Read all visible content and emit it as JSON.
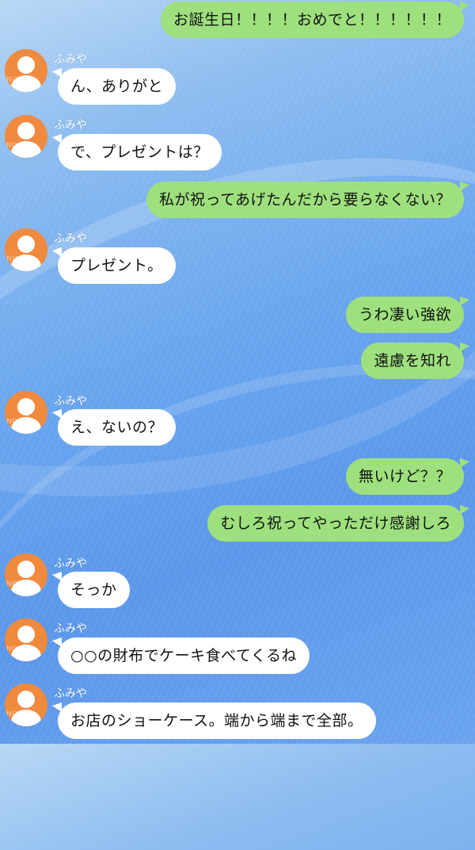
{
  "contact": {
    "name": "ふみや",
    "avatar_watermark": "NOSO",
    "avatar_color": "#f08a3e"
  },
  "colors": {
    "sent_bubble": "#9ee07e",
    "received_bubble": "#ffffff"
  },
  "messages": [
    {
      "from": "me",
      "text": "お誕生日！！！！おめでと！！！！！！"
    },
    {
      "from": "them",
      "text": "ん、ありがと"
    },
    {
      "from": "them",
      "text": "で、プレゼントは？"
    },
    {
      "from": "me",
      "text": "私が祝ってあげたんだから要らなくない？"
    },
    {
      "from": "them",
      "text": "プレゼント。"
    },
    {
      "from": "me",
      "text": "うわ凄い強欲"
    },
    {
      "from": "me",
      "text": "遠慮を知れ"
    },
    {
      "from": "them",
      "text": "え、ないの？"
    },
    {
      "from": "me",
      "text": "無いけど？？"
    },
    {
      "from": "me",
      "text": "むしろ祝ってやっただけ感謝しろ"
    },
    {
      "from": "them",
      "text": "そっか"
    },
    {
      "from": "them",
      "text": "○○の財布でケーキ食べてくるね"
    },
    {
      "from": "them",
      "text": "お店のショーケース。端から端まで全部。"
    }
  ]
}
